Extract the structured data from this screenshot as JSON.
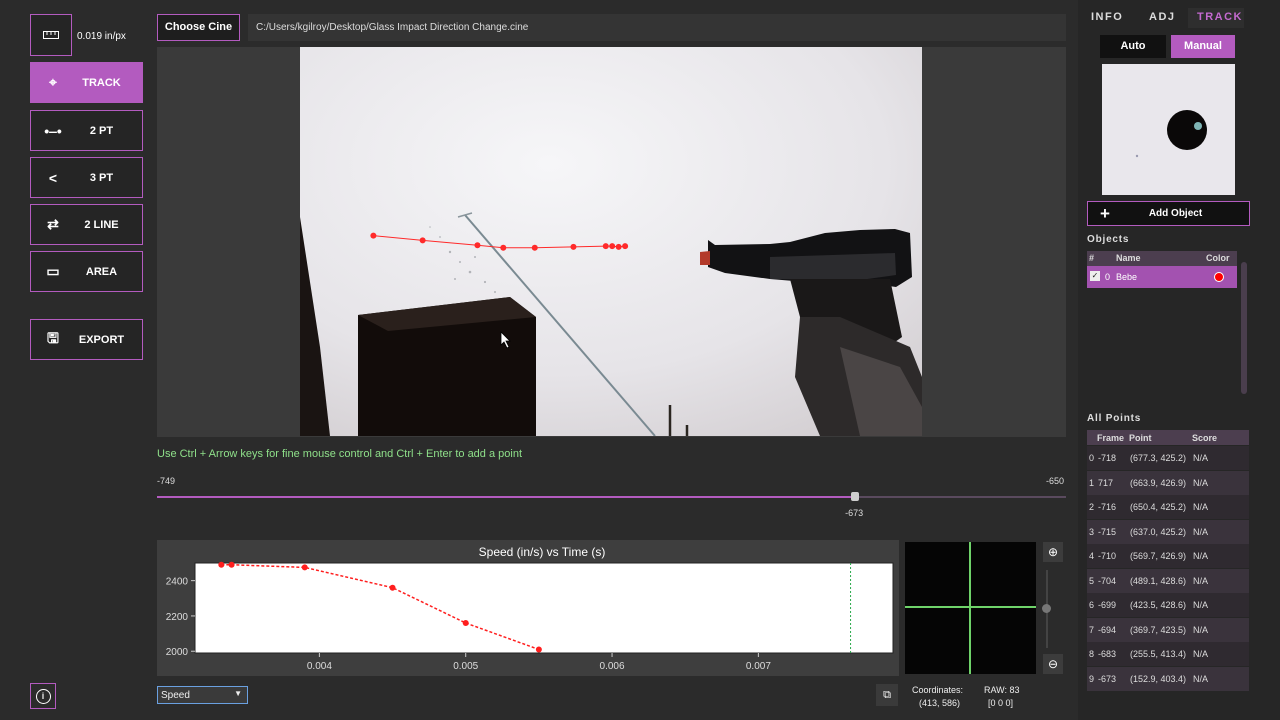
{
  "scale": {
    "value": "0.019 in/px",
    "icon": "ruler-icon"
  },
  "tools": [
    {
      "label": "TRACK",
      "icon": "crosshair-icon",
      "active": true
    },
    {
      "label": "2 PT",
      "icon": "two-point-icon"
    },
    {
      "label": "3 PT",
      "icon": "angle-icon"
    },
    {
      "label": "2 LINE",
      "icon": "two-line-icon"
    },
    {
      "label": "AREA",
      "icon": "area-icon"
    }
  ],
  "export_label": "EXPORT",
  "choose_cine_label": "Choose Cine",
  "file_path": "C:/Users/kgilroy/Desktop/Glass Impact Direction Change.cine",
  "hint": "Use Ctrl + Arrow keys for fine mouse control and Ctrl + Enter to add a point",
  "slider": {
    "min": "-749",
    "max": "-650",
    "current": "-673",
    "fraction": 0.768
  },
  "tracked_points": [
    [
      677.3,
      425.2
    ],
    [
      663.9,
      426.9
    ],
    [
      650.4,
      425.2
    ],
    [
      637.0,
      425.2
    ],
    [
      569.7,
      426.9
    ],
    [
      489.1,
      428.6
    ],
    [
      423.5,
      428.6
    ],
    [
      369.7,
      423.5
    ],
    [
      255.5,
      413.4
    ],
    [
      152.9,
      403.4
    ]
  ],
  "chart_data": {
    "type": "line",
    "title": "Speed (in/s) vs Time (s)",
    "xlabel": "",
    "ylabel": "",
    "xlim": [
      0.00315,
      0.00792
    ],
    "ylim": [
      1990,
      2500
    ],
    "xticks": [
      "0.004",
      "0.005",
      "0.006",
      "0.007"
    ],
    "yticks": [
      "2000",
      "2200",
      "2400"
    ],
    "x": [
      0.00333,
      0.0034,
      0.0039,
      0.0045,
      0.005,
      0.0055
    ],
    "y": [
      2490,
      2490,
      2475,
      2360,
      2160,
      2010
    ],
    "marker_x": 0.00763,
    "grid": false,
    "legend": "none"
  },
  "plot_selector": {
    "selected": "Speed"
  },
  "coordinates": {
    "label": "Coordinates:",
    "value": "(413, 586)"
  },
  "raw": {
    "label": "RAW: 83",
    "value": "[0 0 0]"
  },
  "tabs": [
    "INFO",
    "ADJ",
    "TRACK"
  ],
  "mode": {
    "auto": "Auto",
    "manual": "Manual"
  },
  "add_object_label": "Add Object",
  "objects_title": "Objects",
  "objects_headers": {
    "num": "#",
    "name": "Name",
    "color": "Color"
  },
  "objects": [
    {
      "id": "0",
      "name": "Bebe",
      "color": "#ff0000",
      "checked": "✓"
    }
  ],
  "all_points_title": "All Points",
  "points_headers": {
    "frame": "Frame",
    "point": "Point",
    "score": "Score"
  },
  "points": [
    {
      "idx": "0",
      "frame": "-718",
      "point": "(677.3, 425.2)",
      "score": "N/A"
    },
    {
      "idx": "1",
      "frame": "717",
      "point": "(663.9, 426.9)",
      "score": "N/A"
    },
    {
      "idx": "2",
      "frame": "-716",
      "point": "(650.4, 425.2)",
      "score": "N/A"
    },
    {
      "idx": "3",
      "frame": "-715",
      "point": "(637.0, 425.2)",
      "score": "N/A"
    },
    {
      "idx": "4",
      "frame": "-710",
      "point": "(569.7, 426.9)",
      "score": "N/A"
    },
    {
      "idx": "5",
      "frame": "-704",
      "point": "(489.1, 428.6)",
      "score": "N/A"
    },
    {
      "idx": "6",
      "frame": "-699",
      "point": "(423.5, 428.6)",
      "score": "N/A"
    },
    {
      "idx": "7",
      "frame": "-694",
      "point": "(369.7, 423.5)",
      "score": "N/A"
    },
    {
      "idx": "8",
      "frame": "-683",
      "point": "(255.5, 413.4)",
      "score": "N/A"
    },
    {
      "idx": "9",
      "frame": "-673",
      "point": "(152.9, 403.4)",
      "score": "N/A"
    }
  ],
  "colors": {
    "accent": "#b35bbf",
    "track": "#ff2a2a",
    "hint": "#8fe08a"
  }
}
